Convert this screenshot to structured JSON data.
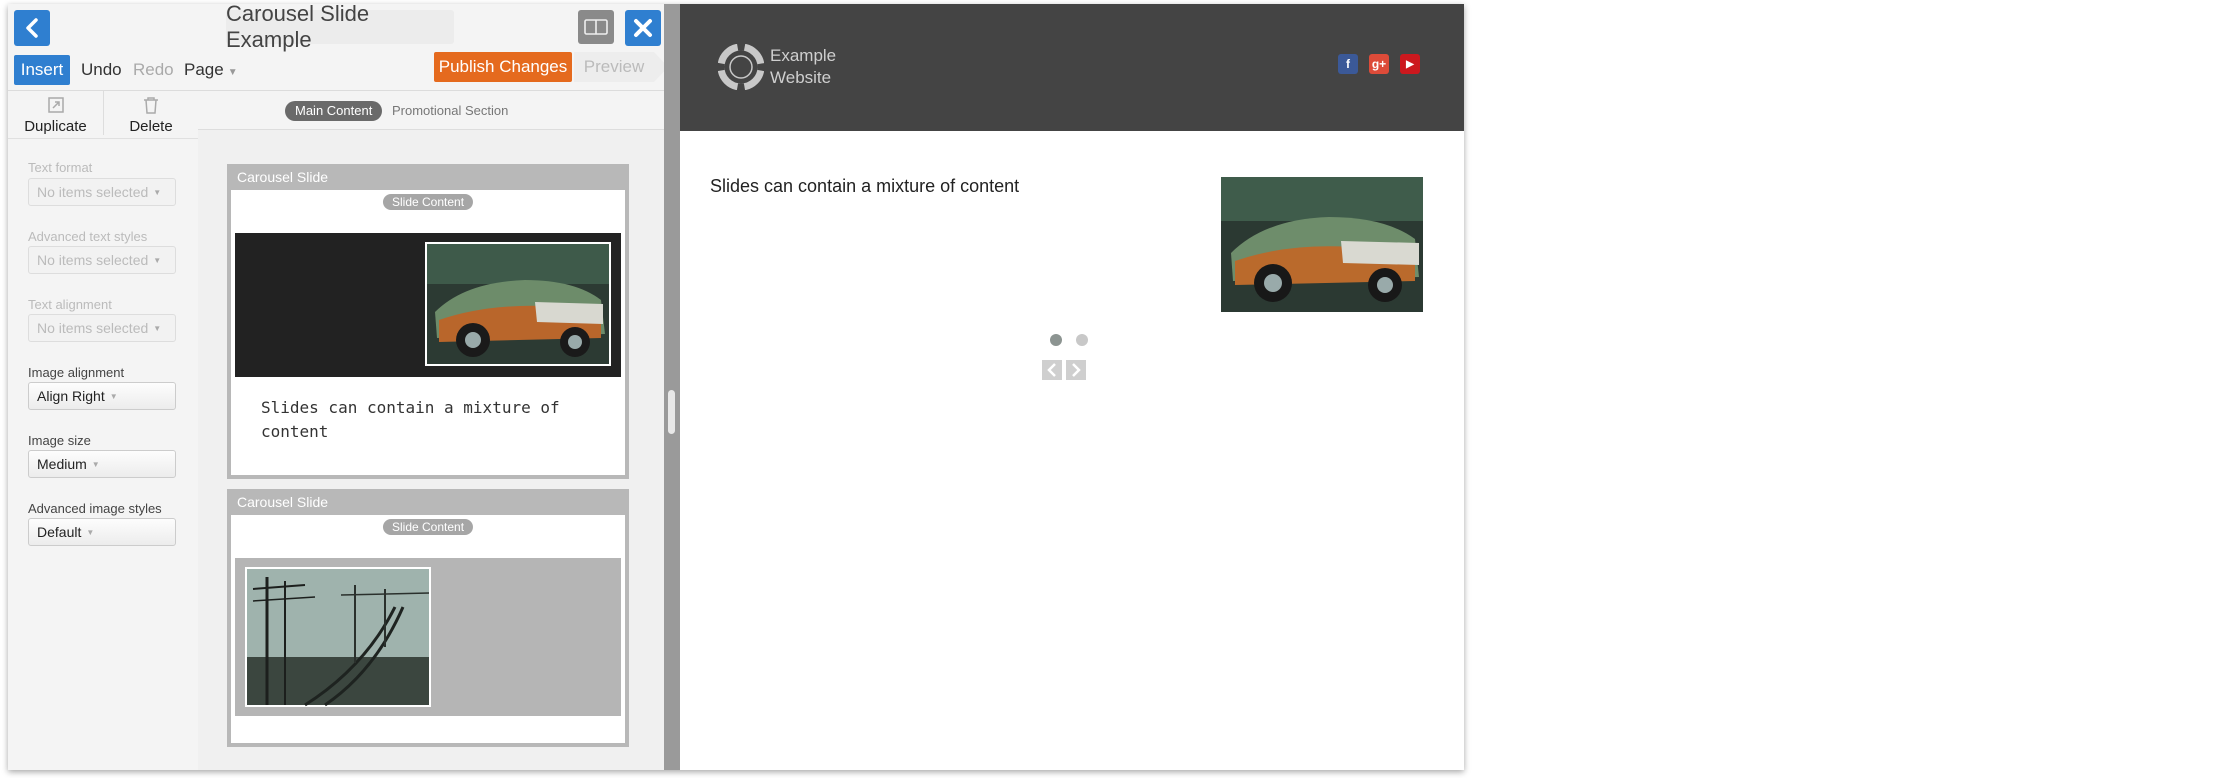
{
  "window": {
    "title": "Carousel Slide Example"
  },
  "toolbar": {
    "insert": "Insert",
    "undo": "Undo",
    "redo": "Redo",
    "page": "Page",
    "publish": "Publish Changes",
    "preview": "Preview"
  },
  "side_tools": {
    "duplicate": "Duplicate",
    "delete": "Delete"
  },
  "properties": {
    "text_format": {
      "label": "Text format",
      "value": "No items selected"
    },
    "advanced_text_styles": {
      "label": "Advanced text styles",
      "value": "No items selected"
    },
    "text_alignment": {
      "label": "Text alignment",
      "value": "No items selected"
    },
    "image_alignment": {
      "label": "Image alignment",
      "value": "Align Right"
    },
    "image_size": {
      "label": "Image size",
      "value": "Medium"
    },
    "advanced_image_styles": {
      "label": "Advanced image styles",
      "value": "Default"
    }
  },
  "section_tabs": {
    "main": "Main Content",
    "promo": "Promotional Section"
  },
  "slides": [
    {
      "header": "Carousel Slide",
      "badge": "Slide Content",
      "text": "Slides can contain a mixture of content"
    },
    {
      "header": "Carousel Slide",
      "badge": "Slide Content"
    }
  ],
  "site": {
    "name_line1": "Example",
    "name_line2": "Website",
    "social": {
      "facebook": "f",
      "google_plus": "g+",
      "youtube": "▶"
    },
    "slide_text": "Slides can contain a mixture of content"
  },
  "colors": {
    "accent_blue": "#2f7fd0",
    "publish_orange": "#e56a1e",
    "site_header": "#444444",
    "facebook": "#3b5998",
    "google_plus": "#dd4b39",
    "youtube": "#cc181e"
  }
}
